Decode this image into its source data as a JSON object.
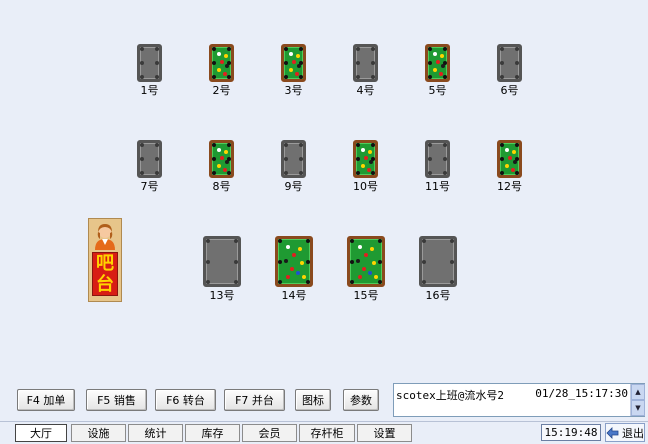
{
  "tables": [
    {
      "label": "1号",
      "status": "idle"
    },
    {
      "label": "2号",
      "status": "busy"
    },
    {
      "label": "3号",
      "status": "busy"
    },
    {
      "label": "4号",
      "status": "idle"
    },
    {
      "label": "5号",
      "status": "busy"
    },
    {
      "label": "6号",
      "status": "idle"
    },
    {
      "label": "7号",
      "status": "idle"
    },
    {
      "label": "8号",
      "status": "busy"
    },
    {
      "label": "9号",
      "status": "idle"
    },
    {
      "label": "10号",
      "status": "busy"
    },
    {
      "label": "11号",
      "status": "idle"
    },
    {
      "label": "12号",
      "status": "busy"
    },
    {
      "label": "13号",
      "status": "idle"
    },
    {
      "label": "14号",
      "status": "busy"
    },
    {
      "label": "15号",
      "status": "busy"
    },
    {
      "label": "16号",
      "status": "idle"
    }
  ],
  "bar": {
    "sign": "吧台"
  },
  "toolbar": {
    "add_order": "F4 加单",
    "sales": "F5 销售",
    "transfer": "F6 转台",
    "merge": "F7 并台",
    "icon": "图标",
    "params": "参数"
  },
  "log": {
    "message": "scotex上班@流水号2",
    "time": "01/28_15:17:30"
  },
  "tabs": {
    "hall": "大厅",
    "facility": "设施",
    "stats": "统计",
    "stock": "库存",
    "member": "会员",
    "cue_cabinet": "存杆柜",
    "settings": "设置"
  },
  "status": {
    "clock": "15:19:48",
    "exit": "退出"
  },
  "colors": {
    "background": "#e9eef8",
    "felt_busy": "#1f9a32",
    "felt_idle": "#707070",
    "rail_busy": "#8a4a1e",
    "bar_sign": "#d81d14"
  }
}
